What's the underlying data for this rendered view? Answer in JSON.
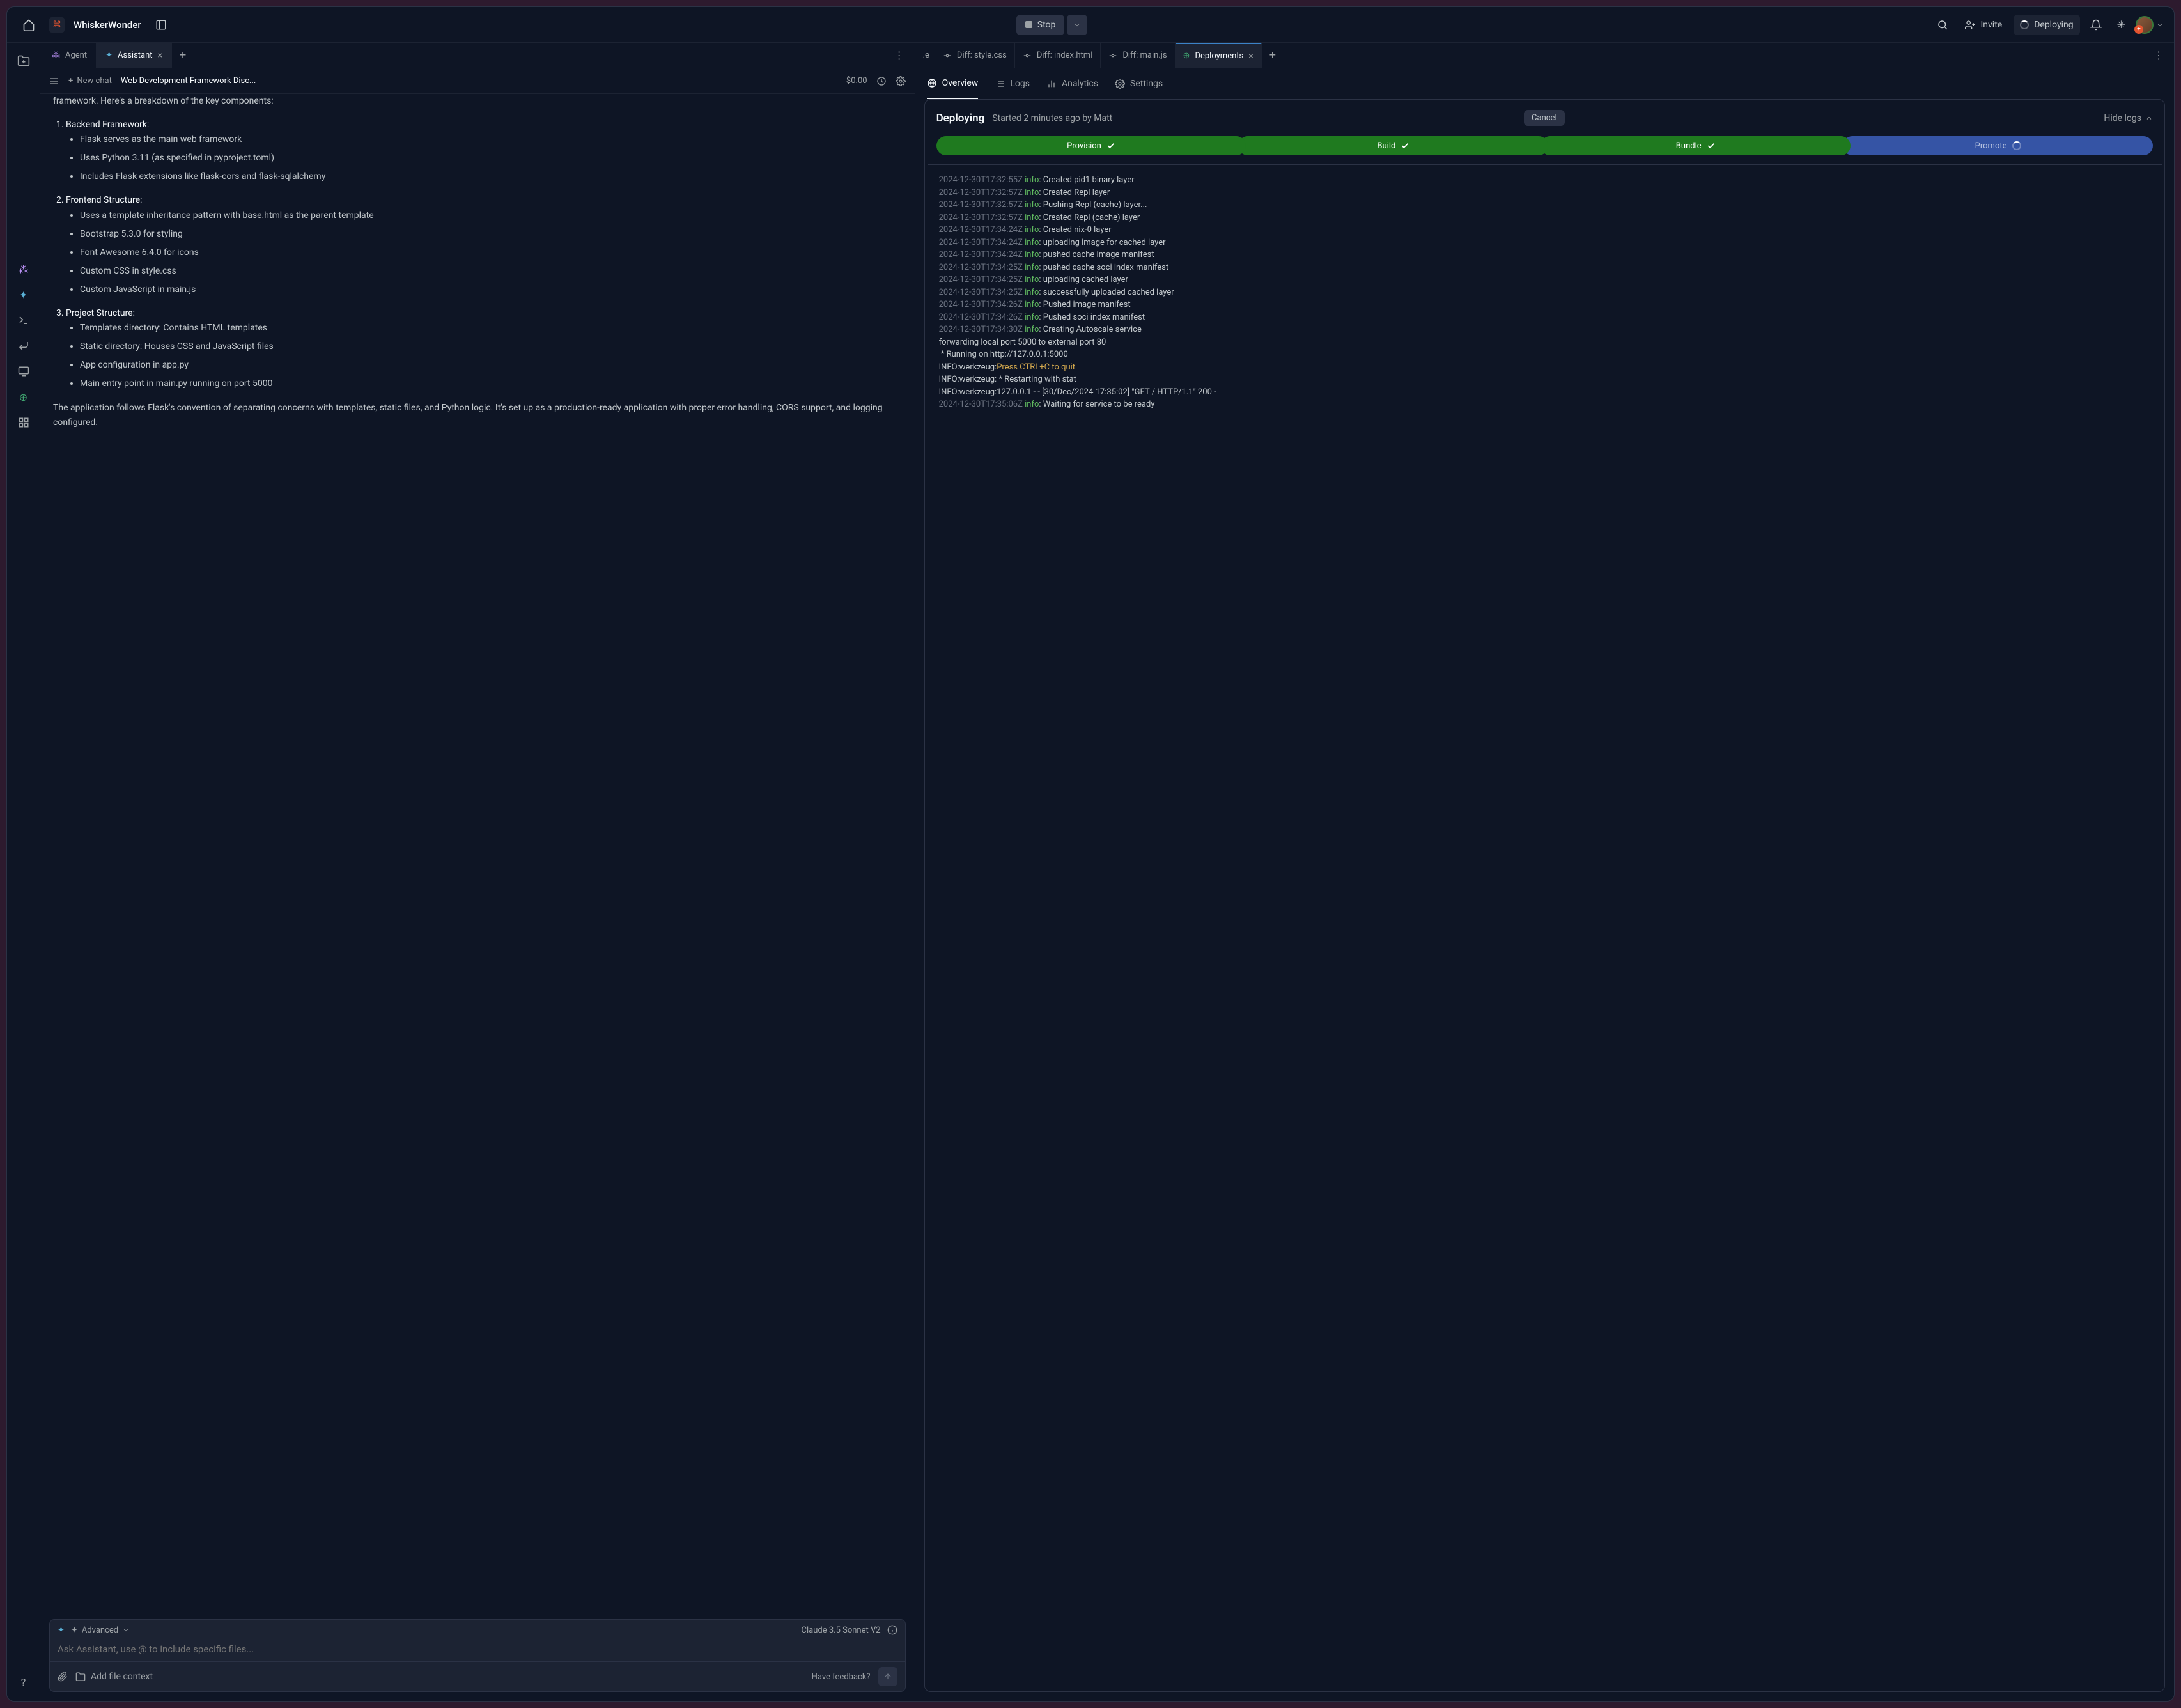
{
  "titlebar": {
    "project_name": "WhiskerWonder",
    "stop": "Stop",
    "invite": "Invite",
    "deploying": "Deploying"
  },
  "left": {
    "tabs": {
      "agent": "Agent",
      "assistant": "Assistant"
    },
    "subheader": {
      "new_chat": "New chat",
      "title": "Web Development Framework Disc...",
      "cost": "$0.00"
    },
    "chat": {
      "intro": "framework. Here's a breakdown of the key components:",
      "h1": "Backend Framework:",
      "b1": "Flask serves as the main web framework",
      "b2": "Uses Python 3.11 (as specified in pyproject.toml)",
      "b3": "Includes Flask extensions like flask-cors and flask-sqlalchemy",
      "h2": "Frontend Structure:",
      "f1": "Uses a template inheritance pattern with base.html as the parent template",
      "f2": "Bootstrap 5.3.0 for styling",
      "f3": "Font Awesome 6.4.0 for icons",
      "f4": "Custom CSS in style.css",
      "f5": "Custom JavaScript in main.js",
      "h3": "Project Structure:",
      "p1": "Templates directory: Contains HTML templates",
      "p2": "Static directory: Houses CSS and JavaScript files",
      "p3": "App configuration in app.py",
      "p4": "Main entry point in main.py running on port 5000",
      "outro": "The application follows Flask's convention of separating concerns with templates, static files, and Python logic. It's set up as a production-ready application with proper error handling, CORS support, and logging configured."
    },
    "composer": {
      "advanced": "Advanced",
      "model": "Claude 3.5 Sonnet V2",
      "placeholder": "Ask Assistant, use @ to include specific files...",
      "add_file": "Add file context",
      "feedback": "Have feedback?"
    }
  },
  "right": {
    "tabs": {
      "e": ".e",
      "style": "Diff: style.css",
      "index": "Diff: index.html",
      "main": "Diff: main.js",
      "deployments": "Deployments"
    },
    "subtabs": {
      "overview": "Overview",
      "logs": "Logs",
      "analytics": "Analytics",
      "settings": "Settings"
    },
    "header": {
      "title": "Deploying",
      "subtitle": "Started 2 minutes ago by Matt",
      "cancel": "Cancel",
      "hide": "Hide logs"
    },
    "pills": {
      "provision": "Provision",
      "build": "Build",
      "bundle": "Bundle",
      "promote": "Promote"
    },
    "logs": [
      {
        "ts": "2024-12-30T17:32:55Z",
        "lvl": "info",
        "msg": "Created pid1 binary layer"
      },
      {
        "ts": "2024-12-30T17:32:57Z",
        "lvl": "info",
        "msg": "Created Repl layer"
      },
      {
        "ts": "2024-12-30T17:32:57Z",
        "lvl": "info",
        "msg": "Pushing Repl (cache) layer..."
      },
      {
        "ts": "2024-12-30T17:32:57Z",
        "lvl": "info",
        "msg": "Created Repl (cache) layer"
      },
      {
        "ts": "2024-12-30T17:34:24Z",
        "lvl": "info",
        "msg": "Created nix-0 layer"
      },
      {
        "ts": "2024-12-30T17:34:24Z",
        "lvl": "info",
        "msg": "uploading image for cached layer"
      },
      {
        "ts": "2024-12-30T17:34:24Z",
        "lvl": "info",
        "msg": "pushed cache image manifest"
      },
      {
        "ts": "2024-12-30T17:34:25Z",
        "lvl": "info",
        "msg": "pushed cache soci index manifest"
      },
      {
        "ts": "2024-12-30T17:34:25Z",
        "lvl": "info",
        "msg": "uploading cached layer"
      },
      {
        "ts": "2024-12-30T17:34:25Z",
        "lvl": "info",
        "msg": "successfully uploaded cached layer"
      },
      {
        "ts": "2024-12-30T17:34:26Z",
        "lvl": "info",
        "msg": "Pushed image manifest"
      },
      {
        "ts": "2024-12-30T17:34:26Z",
        "lvl": "info",
        "msg": "Pushed soci index manifest"
      },
      {
        "ts": "2024-12-30T17:34:30Z",
        "lvl": "info",
        "msg": "Creating Autoscale service"
      }
    ],
    "plain_logs": {
      "l1": "forwarding local port 5000 to external port 80",
      "l2": " * Running on http://127.0.0.1:5000",
      "l3a": "INFO:werkzeug:",
      "l3b": "Press CTRL+C to quit",
      "l4": "INFO:werkzeug: * Restarting with stat",
      "l5": "INFO:werkzeug:127.0.0.1 - - [30/Dec/2024 17:35:02] \"GET / HTTP/1.1\" 200 -"
    },
    "last_log": {
      "ts": "2024-12-30T17:35:06Z",
      "lvl": "info",
      "msg": "Waiting for service to be ready"
    }
  }
}
